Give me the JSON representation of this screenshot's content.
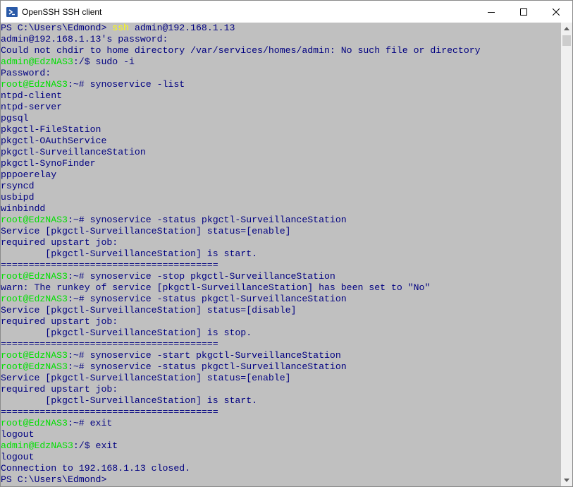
{
  "window": {
    "title": "OpenSSH SSH client",
    "icons": {
      "app": "powershell-icon",
      "minimize": "minimize-icon",
      "maximize": "maximize-icon",
      "close": "close-icon"
    }
  },
  "colors": {
    "background": "#c0c0c0",
    "default_text": "#000080",
    "prompt": "#00e000",
    "command_highlight": "#ffff00"
  },
  "terminal": {
    "lines": [
      [
        {
          "t": "PS C:\\Users\\Edmond> "
        },
        {
          "t": "ssh",
          "c": "cmd"
        },
        {
          "t": " admin@192.168.1.13"
        }
      ],
      [
        {
          "t": "admin@192.168.1.13's password:"
        }
      ],
      [
        {
          "t": "Could not chdir to home directory /var/services/homes/admin: No such file or directory"
        }
      ],
      [
        {
          "t": "admin@EdzNAS3",
          "c": "prompt"
        },
        {
          "t": ":/$ sudo -i"
        }
      ],
      [
        {
          "t": "Password:"
        }
      ],
      [
        {
          "t": "root@EdzNAS3",
          "c": "prompt"
        },
        {
          "t": ":~# synoservice -list"
        }
      ],
      [
        {
          "t": "ntpd-client"
        }
      ],
      [
        {
          "t": "ntpd-server"
        }
      ],
      [
        {
          "t": "pgsql"
        }
      ],
      [
        {
          "t": "pkgctl-FileStation"
        }
      ],
      [
        {
          "t": "pkgctl-OAuthService"
        }
      ],
      [
        {
          "t": "pkgctl-SurveillanceStation"
        }
      ],
      [
        {
          "t": "pkgctl-SynoFinder"
        }
      ],
      [
        {
          "t": "pppoerelay"
        }
      ],
      [
        {
          "t": "rsyncd"
        }
      ],
      [
        {
          "t": "usbipd"
        }
      ],
      [
        {
          "t": "winbindd"
        }
      ],
      [
        {
          "t": "root@EdzNAS3",
          "c": "prompt"
        },
        {
          "t": ":~# synoservice -status pkgctl-SurveillanceStation"
        }
      ],
      [
        {
          "t": "Service [pkgctl-SurveillanceStation] status=[enable]"
        }
      ],
      [
        {
          "t": "required upstart job:"
        }
      ],
      [
        {
          "t": "        [pkgctl-SurveillanceStation] is start."
        }
      ],
      [
        {
          "t": "======================================="
        }
      ],
      [
        {
          "t": "root@EdzNAS3",
          "c": "prompt"
        },
        {
          "t": ":~# synoservice -stop pkgctl-SurveillanceStation"
        }
      ],
      [
        {
          "t": "warn: The runkey of service [pkgctl-SurveillanceStation] has been set to \"No\""
        }
      ],
      [
        {
          "t": "root@EdzNAS3",
          "c": "prompt"
        },
        {
          "t": ":~# synoservice -status pkgctl-SurveillanceStation"
        }
      ],
      [
        {
          "t": "Service [pkgctl-SurveillanceStation] status=[disable]"
        }
      ],
      [
        {
          "t": "required upstart job:"
        }
      ],
      [
        {
          "t": "        [pkgctl-SurveillanceStation] is stop."
        }
      ],
      [
        {
          "t": "======================================="
        }
      ],
      [
        {
          "t": "root@EdzNAS3",
          "c": "prompt"
        },
        {
          "t": ":~# synoservice -start pkgctl-SurveillanceStation"
        }
      ],
      [
        {
          "t": "root@EdzNAS3",
          "c": "prompt"
        },
        {
          "t": ":~# synoservice -status pkgctl-SurveillanceStation"
        }
      ],
      [
        {
          "t": "Service [pkgctl-SurveillanceStation] status=[enable]"
        }
      ],
      [
        {
          "t": "required upstart job:"
        }
      ],
      [
        {
          "t": "        [pkgctl-SurveillanceStation] is start."
        }
      ],
      [
        {
          "t": "======================================="
        }
      ],
      [
        {
          "t": "root@EdzNAS3",
          "c": "prompt"
        },
        {
          "t": ":~# exit"
        }
      ],
      [
        {
          "t": "logout"
        }
      ],
      [
        {
          "t": "admin@EdzNAS3",
          "c": "prompt"
        },
        {
          "t": ":/$ exit"
        }
      ],
      [
        {
          "t": "logout"
        }
      ],
      [
        {
          "t": "Connection to 192.168.1.13 closed."
        }
      ],
      [
        {
          "t": "PS C:\\Users\\Edmond>"
        }
      ]
    ]
  },
  "scrollbar": {
    "up_icon": "scroll-up-arrow-icon",
    "down_icon": "scroll-down-arrow-icon"
  }
}
